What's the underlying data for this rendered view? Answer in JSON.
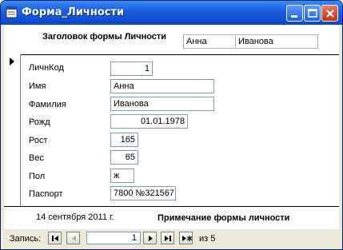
{
  "window": {
    "title": "Форма_Личности"
  },
  "header": {
    "title": "Заголовок формы Личности",
    "first_name": "Анна",
    "last_name": "Иванова"
  },
  "fields": [
    {
      "label": "ЛичнКод",
      "value": "1"
    },
    {
      "label": "Имя",
      "value": "Анна"
    },
    {
      "label": "Фамилия",
      "value": "Иванова"
    },
    {
      "label": "Рожд",
      "value": "01.01.1978"
    },
    {
      "label": "Рост",
      "value": "165"
    },
    {
      "label": "Вес",
      "value": "65"
    },
    {
      "label": "Пол",
      "value": "ж"
    },
    {
      "label": "Паспорт",
      "value": "7800 №321567"
    }
  ],
  "footer": {
    "date": "14 сентября 2011 г.",
    "note": "Примечание формы личности"
  },
  "navigation": {
    "label": "Запись:",
    "current": "1",
    "of_label": "из",
    "total": "5"
  }
}
